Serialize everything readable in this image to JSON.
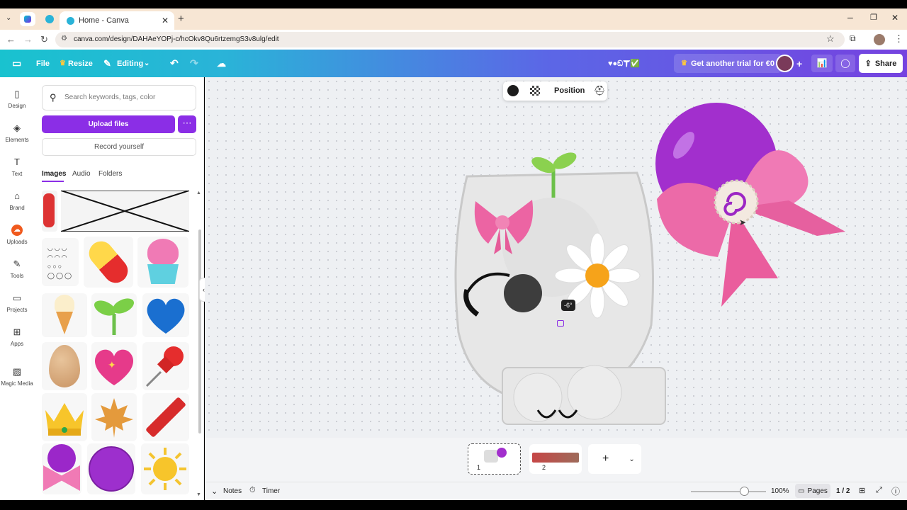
{
  "browser": {
    "tab_title": "Home - Canva",
    "url": "canva.com/design/DAHAeYOPj-c/hcOkv8Qu6rtzemgS3v8ulg/edit"
  },
  "toolbar": {
    "file": "File",
    "resize": "Resize",
    "editing": "Editing",
    "trial": "Get another trial for €0",
    "share": "Share",
    "emoji_title": "♥●ඞ☤✅"
  },
  "rail": [
    {
      "label": "Design",
      "icon": "design-icon"
    },
    {
      "label": "Elements",
      "icon": "elements-icon"
    },
    {
      "label": "Text",
      "icon": "text-icon"
    },
    {
      "label": "Brand",
      "icon": "brand-icon"
    },
    {
      "label": "Uploads",
      "icon": "uploads-icon"
    },
    {
      "label": "Tools",
      "icon": "tools-icon"
    },
    {
      "label": "Projects",
      "icon": "projects-icon"
    },
    {
      "label": "Apps",
      "icon": "apps-icon"
    },
    {
      "label": "Magic Media",
      "icon": "magic-media-icon"
    }
  ],
  "panel": {
    "search_placeholder": "Search keywords, tags, color",
    "upload": "Upload files",
    "record": "Record yourself",
    "tabs": [
      "Images",
      "Audio",
      "Folders"
    ]
  },
  "context_toolbar": {
    "position": "Position"
  },
  "canvas": {
    "rotation_badge": "-6°"
  },
  "pages": [
    {
      "number": "1"
    },
    {
      "number": "2"
    }
  ],
  "footer": {
    "notes": "Notes",
    "timer": "Timer",
    "zoom": "100%",
    "pages_label": "Pages",
    "page_count": "1 / 2"
  },
  "colors": {
    "accent": "#7d2ae8",
    "brand_gradient_start": "#19c2cf",
    "brand_gradient_end": "#7542e0"
  }
}
